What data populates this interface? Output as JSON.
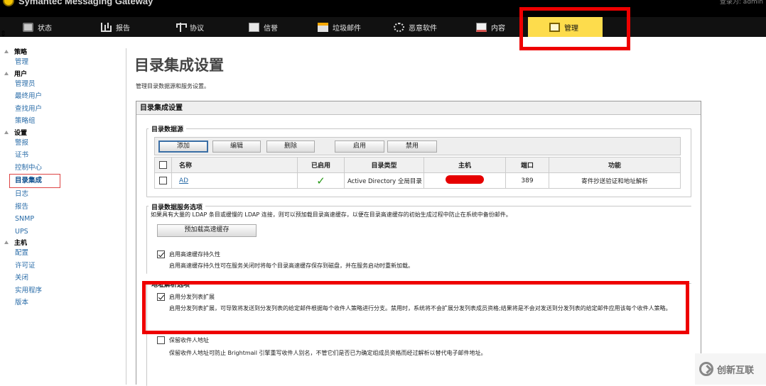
{
  "app": {
    "brand": "Symantec Messaging Gateway",
    "user_info": "登录为: admin"
  },
  "nav": [
    {
      "label": "状态",
      "icon": "status-icon"
    },
    {
      "label": "报告",
      "icon": "report-chart-icon"
    },
    {
      "label": "协议",
      "icon": "protocol-icon"
    },
    {
      "label": "信誉",
      "icon": "reputation-mail-icon"
    },
    {
      "label": "垃圾邮件",
      "icon": "spam-icon"
    },
    {
      "label": "恶意软件",
      "icon": "malware-icon"
    },
    {
      "label": "内容",
      "icon": "content-icon"
    },
    {
      "label": "管理",
      "icon": "admin-icon",
      "active": true
    }
  ],
  "sidebar": {
    "policy": {
      "title": "策略",
      "items": [
        "管理"
      ]
    },
    "users": {
      "title": "用户",
      "items": [
        "管理员",
        "最终用户",
        "查找用户",
        "策略组"
      ]
    },
    "settings": {
      "title": "设置",
      "items": [
        "警报",
        "证书",
        "控制中心",
        "目录集成",
        "日志",
        "报告",
        "SNMP",
        "UPS"
      ]
    },
    "hosts": {
      "title": "主机",
      "items": [
        "配置",
        "许可证",
        "关闭",
        "实用程序",
        "版本"
      ]
    }
  },
  "page": {
    "title": "目录集成设置",
    "description": "管理目录数据源和服务设置。",
    "panel_title": "目录集成设置"
  },
  "datasources": {
    "legend": "目录数据源",
    "buttons": {
      "add": "添加",
      "edit": "编辑",
      "delete": "删除",
      "enable": "启用",
      "disable": "禁用"
    },
    "columns": [
      "名称",
      "已启用",
      "目录类型",
      "主机",
      "端口",
      "功能"
    ],
    "rows": [
      {
        "name": "AD",
        "enabled": true,
        "type": "Active Directory 全局目录",
        "host": "",
        "port": "389",
        "function": "寄件抄送验证和地址解析"
      }
    ]
  },
  "service": {
    "legend": "目录数据服务选项",
    "description": "如果具有大量的 LDAP 条目或缓慢的 LDAP 连接，则可以预加载目录高速缓存，以便在目录高速缓存的初始生成过程中防止在系统中备份邮件。",
    "preload_button": "预加载高速缓存",
    "persist": {
      "label": "启用高速缓存持久性",
      "checked": true,
      "help": "启用高速缓存持久性可在服务关闭时将每个目录高速缓存保存到磁盘，并在服务启动时重新加载。"
    }
  },
  "address": {
    "legend": "地址解析选项",
    "expand": {
      "label": "启用分发列表扩展",
      "checked": true,
      "help": "启用分发列表扩展，可导致将发送到分发列表的给定邮件根据每个收件人策略进行分支。禁用时，系统将不会扩展分发列表成员资格;结果将是不会对发送到分发列表的给定邮件应用该每个收件人策略。"
    },
    "preserve": {
      "label": "保留收件人地址",
      "checked": false,
      "help": "保留收件人地址可防止 Brightmail 引擎重写收件人别名，不管它们是否已为确定组成员资格而经过解析以替代电子邮件地址。"
    }
  },
  "watermark": "创新互联"
}
